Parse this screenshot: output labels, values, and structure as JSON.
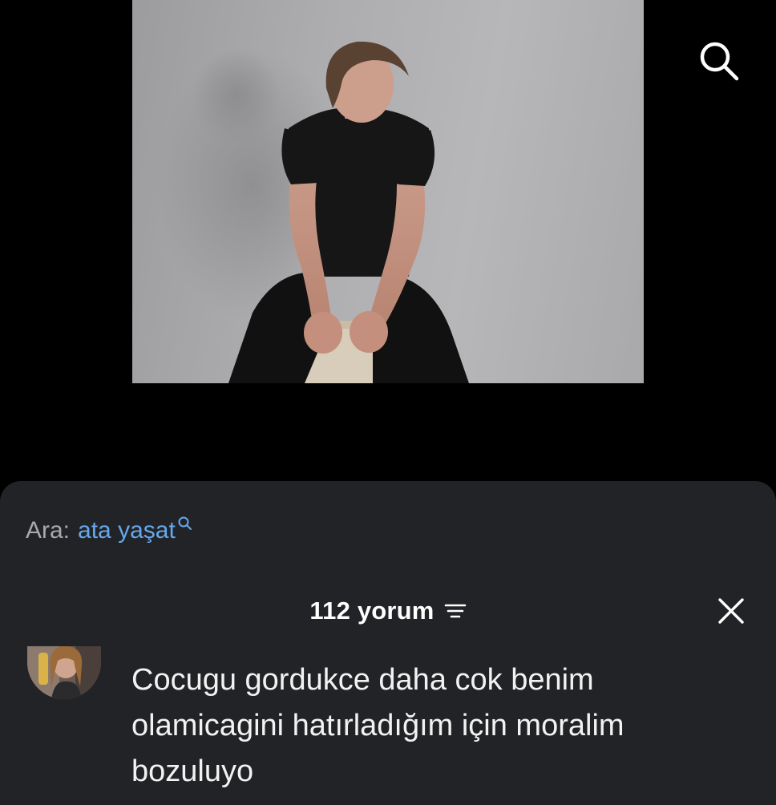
{
  "header": {
    "search_icon": "search-icon"
  },
  "video": {
    "description_icon": "photo-content"
  },
  "sheet": {
    "search_prefix": "Ara:",
    "search_term": "ata yaşat",
    "search_term_icon": "search-icon",
    "comment_count_label": "112 yorum",
    "sort_icon": "sort-icon",
    "close_icon": "close-icon"
  },
  "comments": [
    {
      "avatar_icon": "avatar",
      "text": "Cocugu gordukce daha cok benim olamicagini hatırladığım için moralim bozuluyo"
    }
  ],
  "colors": {
    "background": "#000000",
    "sheet_background": "#222326",
    "link_blue": "#65a8ec",
    "muted_text": "#a9a9ad",
    "text": "#ffffff"
  }
}
